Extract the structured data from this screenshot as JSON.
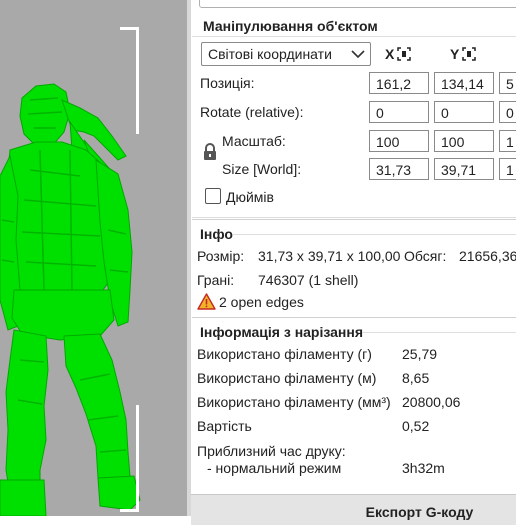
{
  "object_manipulation": {
    "title": "Маніпулювання об'єктом",
    "coord_system": "Світові координати",
    "axis_x": "X",
    "axis_y": "Y",
    "position_label": "Позиція:",
    "rotate_label": "Rotate (relative):",
    "scale_label": "Масштаб:",
    "size_label": "Size [World]:",
    "position": {
      "x": "161,2",
      "y": "134,14",
      "z": "5"
    },
    "rotate": {
      "x": "0",
      "y": "0",
      "z": "0"
    },
    "scale": {
      "x": "100",
      "y": "100",
      "z": "1"
    },
    "size": {
      "x": "31,73",
      "y": "39,71",
      "z": "1"
    },
    "inches_label": "Дюймів",
    "inches_checked": false
  },
  "info": {
    "title": "Інфо",
    "size_label": "Розмір:",
    "size_value": "31,73 x 39,71 x 100,00",
    "volume_label": "Обсяг:",
    "volume_value": "21656,36",
    "facets_label": "Грані:",
    "facets_value": "746307 (1 shell)",
    "warning_text": "2 open edges"
  },
  "slice_info": {
    "title": "Інформація з нарізання",
    "rows": [
      {
        "label": "Використано філаменту (г)",
        "value": "25,79"
      },
      {
        "label": "Використано філаменту (м)",
        "value": "8,65"
      },
      {
        "label": "Використано філаменту (мм³)",
        "value": "20800,06"
      },
      {
        "label": "Вартість",
        "value": "0,52"
      }
    ],
    "print_time_label": "Приблизний час друку:",
    "mode_label": "- нормальний режим",
    "mode_value": "3h32m"
  },
  "export_label": "Експорт G-коду",
  "colors": {
    "model": "#00e600",
    "viewport_bg": "#a9a9a9",
    "warning": "#e8a317"
  }
}
